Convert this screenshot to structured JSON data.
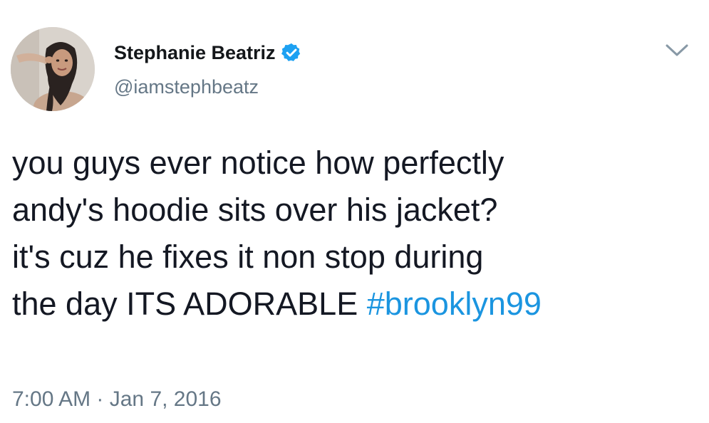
{
  "author": {
    "display_name": "Stephanie Beatriz",
    "handle": "@iamstephbeatz",
    "verified": true,
    "avatar_icon": "profile-photo"
  },
  "tweet": {
    "text_line1": "you guys ever notice how perfectly",
    "text_line2": "andy's hoodie sits over his jacket?",
    "text_line3": "it's cuz he fixes it non stop during",
    "text_line4_prefix": "the day ITS ADORABLE ",
    "hashtag": "#brooklyn99"
  },
  "meta": {
    "time": "7:00 AM",
    "separator": " · ",
    "date": "Jan 7, 2016"
  },
  "icons": {
    "verified": "verified-badge-icon",
    "menu": "chevron-down-icon"
  },
  "colors": {
    "link": "#1b95e0",
    "verified": "#1da1f2",
    "secondary_text": "#657786",
    "primary_text": "#141823"
  }
}
